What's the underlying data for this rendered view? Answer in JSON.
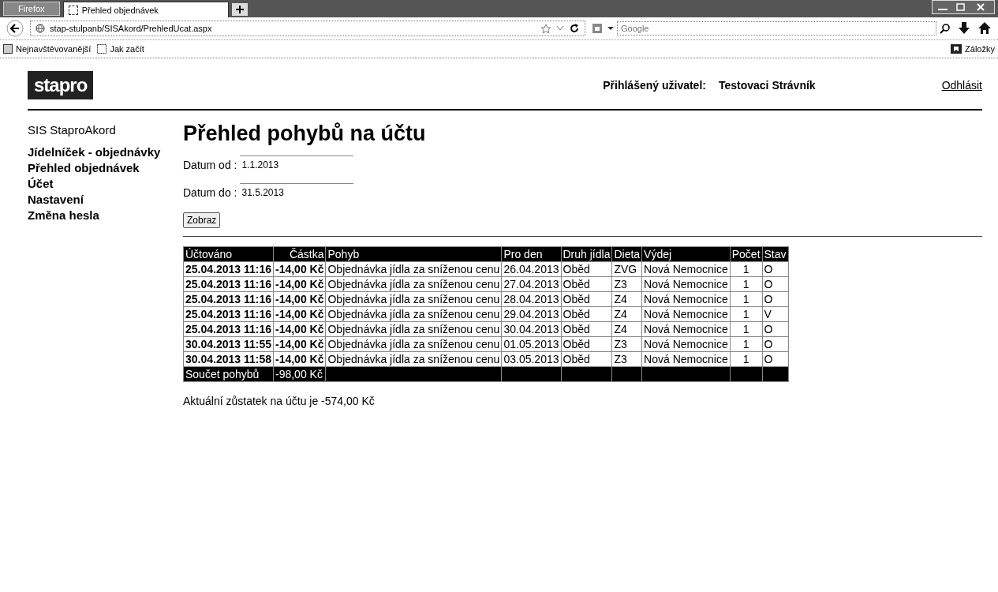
{
  "browser": {
    "menu_button": "Firefox",
    "tabs": [
      {
        "label": "Přehled objednávek",
        "selected": true
      }
    ],
    "url": "stap-stulpanb/SISAkord/PrehledUcat.aspx",
    "search": {
      "placeholder": "Google"
    },
    "bookmarks": [
      "Nejnavštěvovanější",
      "Jak začít"
    ],
    "bookmarks_menu": "Záložky"
  },
  "header": {
    "logo": "stapro",
    "user_label": "Přihlášený uživatel:",
    "user_name": "Testovaci Strávník",
    "logout": "Odhlásit"
  },
  "sidebar": {
    "title": "SIS StaproAkord",
    "items": [
      "Jídelníček - objednávky",
      "Přehled objednávek",
      "Účet",
      "Nastavení",
      "Změna hesla"
    ]
  },
  "heading": "Přehled pohybů na účtu",
  "fields": [
    {
      "label": "Datum od :",
      "value": "1.1.2013"
    },
    {
      "label": "Datum do :",
      "value": "31.5.2013"
    }
  ],
  "show_button": "Zobraz",
  "table": {
    "columns": [
      "Účtováno",
      "Částka",
      "Pohyb",
      "Pro den",
      "Druh jídla",
      "Dieta",
      "Výdej",
      "Počet",
      "Stav"
    ],
    "rows": [
      [
        "25.04.2013 11:16",
        "-14,00 Kč",
        "Objednávka jídla za sníženou cenu",
        "26.04.2013",
        "Oběd",
        "ZVG",
        "Nová Nemocnice",
        "1",
        "O"
      ],
      [
        "25.04.2013 11:16",
        "-14,00 Kč",
        "Objednávka jídla za sníženou cenu",
        "27.04.2013",
        "Oběd",
        "Z3",
        "Nová Nemocnice",
        "1",
        "O"
      ],
      [
        "25.04.2013 11:16",
        "-14,00 Kč",
        "Objednávka jídla za sníženou cenu",
        "28.04.2013",
        "Oběd",
        "Z4",
        "Nová Nemocnice",
        "1",
        "O"
      ],
      [
        "25.04.2013 11:16",
        "-14,00 Kč",
        "Objednávka jídla za sníženou cenu",
        "29.04.2013",
        "Oběd",
        "Z4",
        "Nová Nemocnice",
        "1",
        "V"
      ],
      [
        "25.04.2013 11:16",
        "-14,00 Kč",
        "Objednávka jídla za sníženou cenu",
        "30.04.2013",
        "Oběd",
        "Z4",
        "Nová Nemocnice",
        "1",
        "O"
      ],
      [
        "30.04.2013 11:55",
        "-14,00 Kč",
        "Objednávka jídla za sníženou cenu",
        "01.05.2013",
        "Oběd",
        "Z3",
        "Nová Nemocnice",
        "1",
        "O"
      ],
      [
        "30.04.2013 11:58",
        "-14,00 Kč",
        "Objednávka jídla za sníženou cenu",
        "03.05.2013",
        "Oběd",
        "Z3",
        "Nová Nemocnice",
        "1",
        "O"
      ]
    ],
    "total": {
      "label": "Součet pohybů",
      "value": "-98,00 Kč"
    }
  },
  "balance": "Aktuální zůstatek na účtu je -574,00 Kč"
}
